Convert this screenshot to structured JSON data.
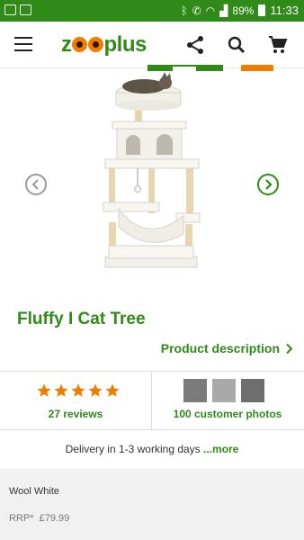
{
  "status_bar": {
    "battery": "89%",
    "time": "11:33"
  },
  "app_bar": {
    "logo_text": "zooplus"
  },
  "product": {
    "title": "Fluffy I Cat Tree",
    "description_link": "Product description",
    "rating_stars": 5,
    "reviews_label": "27 reviews",
    "photos_label": "100 customer photos",
    "delivery_text": "Delivery in 1-3 working days ",
    "delivery_more": "...more"
  },
  "variant": {
    "name": "Wool White",
    "rrp_label": "RRP*",
    "rrp_price": "£79.99"
  },
  "colors": {
    "brand_green": "#2f8a18",
    "brand_orange": "#f07d00",
    "star_orange": "#f07d00"
  }
}
